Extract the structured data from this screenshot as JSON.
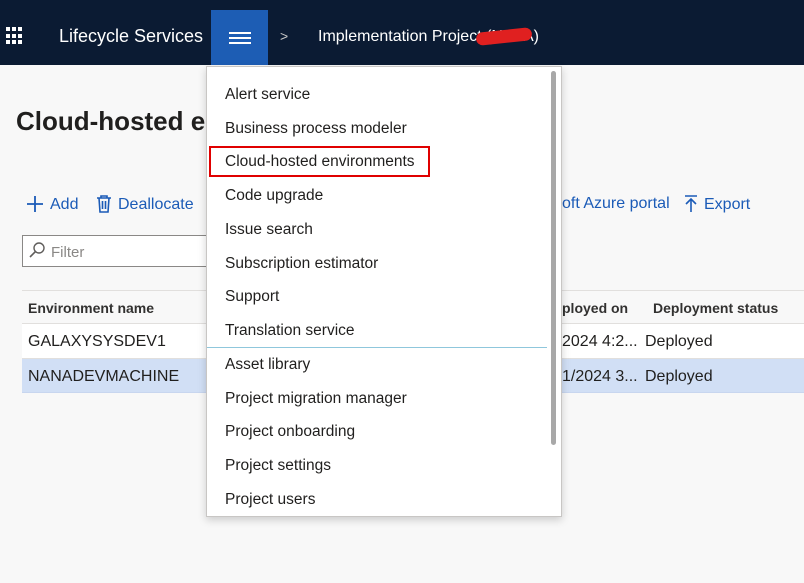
{
  "header": {
    "app_title": "Lifecycle Services",
    "breadcrumb_separator": ">",
    "project_title": "Implementation Project (N",
    "project_title_end": "A)"
  },
  "page": {
    "title": "Cloud-hosted e"
  },
  "toolbar": {
    "add_label": "Add",
    "deallocate_label": "Deallocate",
    "azure_label": "oft Azure portal",
    "export_label": "Export"
  },
  "filter": {
    "placeholder": "Filter"
  },
  "grid": {
    "columns": [
      "Environment name",
      "ployed on",
      "Deployment status"
    ],
    "rows": [
      {
        "name": "GALAXYSYSDEV1",
        "deployed_on": "2024 4:2...",
        "status": "Deployed"
      },
      {
        "name": "NANADEVMACHINE",
        "deployed_on": "1/2024 3...",
        "status": "Deployed"
      }
    ]
  },
  "menu": {
    "items": [
      "Alert service",
      "Business process modeler",
      "Cloud-hosted environments",
      "Code upgrade",
      "Issue search",
      "Subscription estimator",
      "Support",
      "Translation service",
      "Asset library",
      "Project migration manager",
      "Project onboarding",
      "Project settings",
      "Project users"
    ]
  },
  "colors": {
    "header_bg": "#0b1b33",
    "menu_button_bg": "#1d5db4",
    "link_blue": "#1b5bb7",
    "selected_row": "#d1dff5",
    "highlight_border": "#e00000"
  }
}
